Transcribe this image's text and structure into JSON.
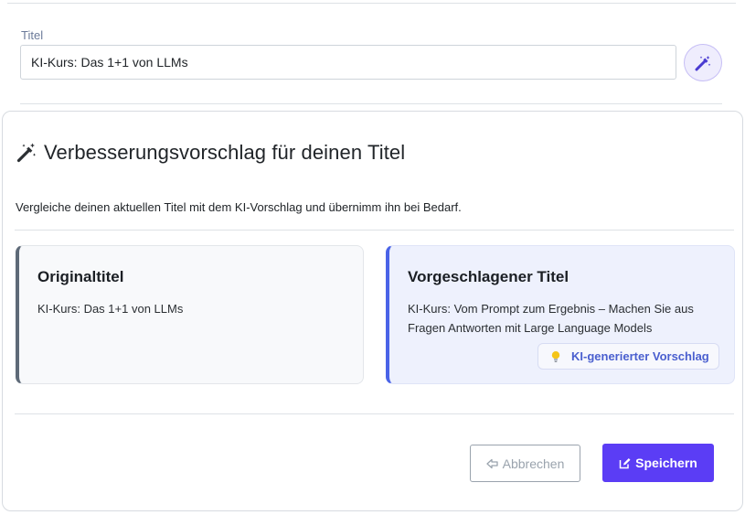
{
  "form": {
    "label": "Titel",
    "title_value": "KI-Kurs: Das 1+1 von LLMs"
  },
  "modal": {
    "title": "Verbesserungsvorschlag für deinen Titel",
    "description": "Vergleiche deinen aktuellen Titel mit dem KI-Vorschlag und übernimm ihn bei Bedarf.",
    "original": {
      "heading": "Originaltitel",
      "text": "KI-Kurs: Das 1+1 von LLMs"
    },
    "suggested": {
      "heading": "Vorgeschlagener Titel",
      "text": "KI-Kurs: Vom Prompt zum Ergebnis – Machen Sie aus Fragen Antworten mit Large Language Models",
      "badge": "KI-generierter Vorschlag"
    },
    "buttons": {
      "cancel": "Abbrechen",
      "save": "Speichern"
    }
  },
  "icons": {
    "magic": "magic-wand-icon",
    "bulb": "lightbulb-icon",
    "cancel": "arrow-left-icon",
    "save": "edit-icon"
  },
  "colors": {
    "accent": "#5b3df5",
    "suggested_border": "#4a63e7",
    "original_border": "#5e6a78"
  }
}
